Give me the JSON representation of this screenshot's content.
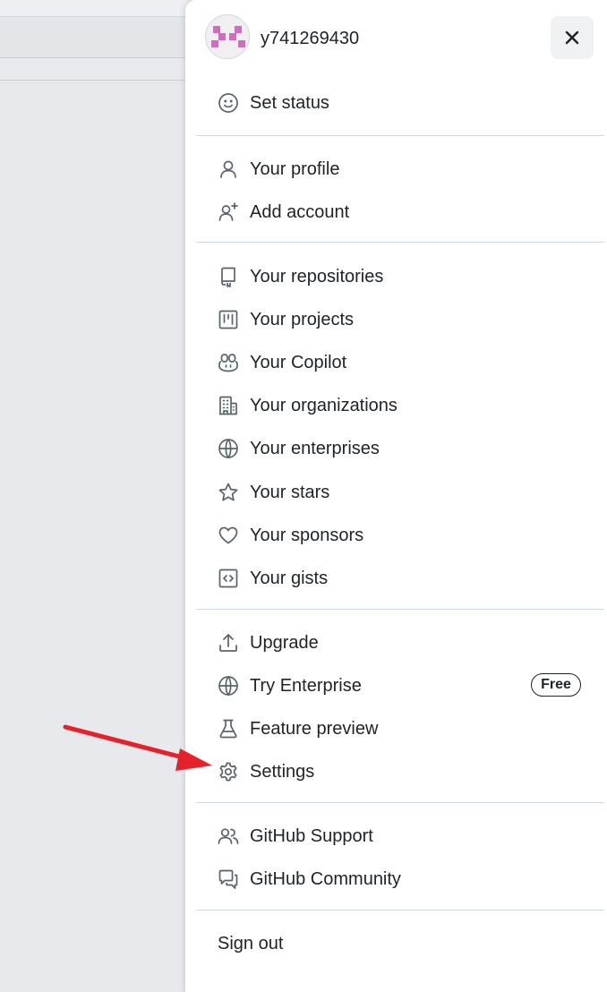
{
  "user": {
    "username": "y741269430"
  },
  "menu": {
    "set_status": "Set status",
    "profile": "Your profile",
    "add_account": "Add account",
    "repositories": "Your repositories",
    "projects": "Your projects",
    "copilot": "Your Copilot",
    "organizations": "Your organizations",
    "enterprises": "Your enterprises",
    "stars": "Your stars",
    "sponsors": "Your sponsors",
    "gists": "Your gists",
    "upgrade": "Upgrade",
    "try_enterprise": "Try Enterprise",
    "try_enterprise_badge": "Free",
    "feature_preview": "Feature preview",
    "settings": "Settings",
    "support": "GitHub Support",
    "community": "GitHub Community",
    "sign_out": "Sign out"
  },
  "colors": {
    "annotation_arrow": "#e5222a",
    "avatar": "#d36cc0"
  }
}
